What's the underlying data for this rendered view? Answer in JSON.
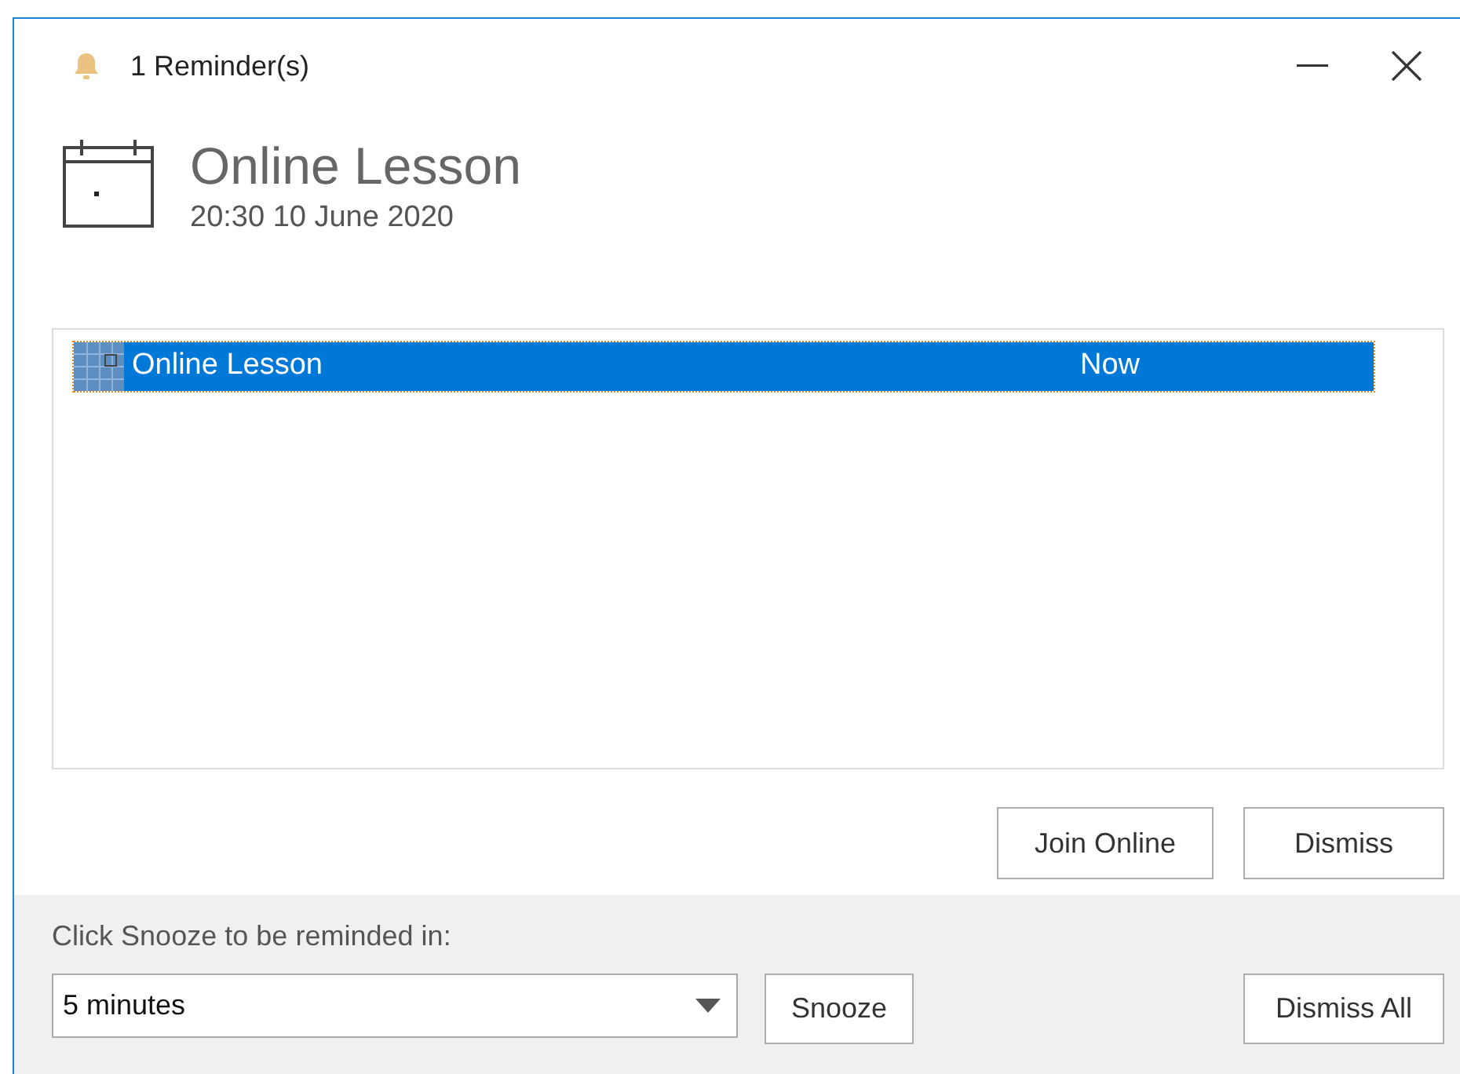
{
  "window": {
    "title": "1 Reminder(s)"
  },
  "header": {
    "subject": "Online Lesson",
    "time": "20:30 10 June 2020"
  },
  "reminders": [
    {
      "subject": "Online Lesson",
      "due": "Now",
      "selected": true
    }
  ],
  "actions": [
    {
      "label": "Join Online"
    },
    {
      "label": "Dismiss"
    }
  ],
  "snooze": {
    "label": "Click Snooze to be reminded in:",
    "value": "5 minutes",
    "button": {
      "label": "Snooze"
    }
  },
  "dismiss_all": {
    "label": "Dismiss All"
  }
}
